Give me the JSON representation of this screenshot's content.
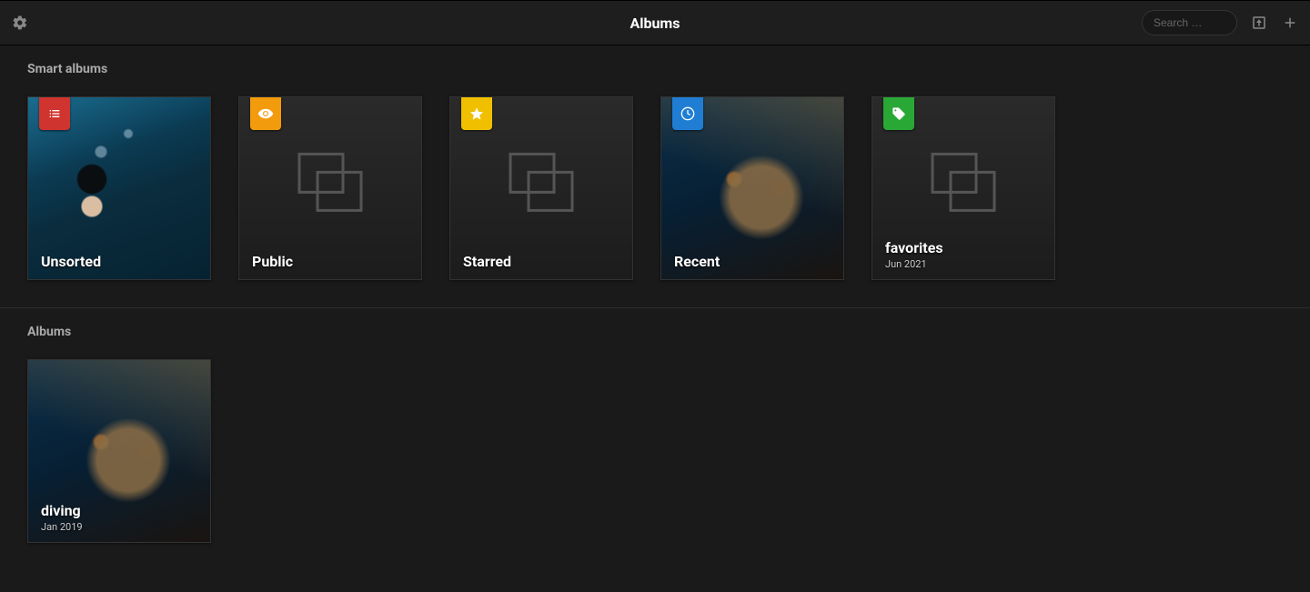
{
  "header": {
    "title": "Albums",
    "search_placeholder": "Search …",
    "icons": {
      "settings": "gear-icon",
      "import": "import-icon",
      "add": "plus-icon"
    }
  },
  "sections": {
    "smart": {
      "title": "Smart albums",
      "items": [
        {
          "title": "Unsorted",
          "subtitle": "",
          "badge_color": "red",
          "icon": "list-icon",
          "thumb": "diver"
        },
        {
          "title": "Public",
          "subtitle": "",
          "badge_color": "orange",
          "icon": "eye-icon",
          "thumb": ""
        },
        {
          "title": "Starred",
          "subtitle": "",
          "badge_color": "yellow",
          "icon": "star-icon",
          "thumb": ""
        },
        {
          "title": "Recent",
          "subtitle": "",
          "badge_color": "blue",
          "icon": "clock-icon",
          "thumb": "fish"
        },
        {
          "title": "favorites",
          "subtitle": "Jun 2021",
          "badge_color": "green",
          "icon": "tag-icon",
          "thumb": ""
        }
      ]
    },
    "albums": {
      "title": "Albums",
      "items": [
        {
          "title": "diving",
          "subtitle": "Jan 2019",
          "thumb": "fish"
        }
      ]
    }
  }
}
